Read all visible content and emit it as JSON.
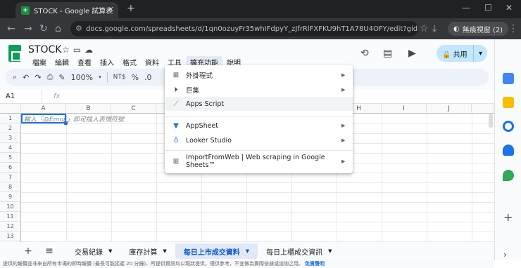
{
  "browser": {
    "tab_title": "STOCK - Google 試算表",
    "url": "docs.google.com/spreadsheets/d/1qn0ozuyFr35whIFdpyY_zJfrRlFXFKU9hT1A78U4OFY/edit?gid=138780...",
    "incognito_label": "無痕視窗 (2)"
  },
  "sheets": {
    "doc_title": "STOCK",
    "menu": [
      "檔案",
      "編輯",
      "查看",
      "插入",
      "格式",
      "資料",
      "工具",
      "擴充功能",
      "說明"
    ],
    "active_menu": "擴充功能",
    "share_label": "共用",
    "zoom": "100%",
    "currency": "NT$",
    "percent": "%",
    "decimal": ".0",
    "name_box": "A1",
    "fx": "fx",
    "cell_hint": "輸入「@Emoji」即可插入表情符號",
    "columns": [
      "A",
      "B",
      "C",
      "D",
      "E",
      "F",
      "G",
      "H",
      "I",
      "J"
    ],
    "rows": [
      "1",
      "2",
      "3",
      "4",
      "5",
      "6",
      "7",
      "8",
      "9",
      "10",
      "11",
      "12",
      "13",
      "14"
    ],
    "disclaimer": "提供的報價並非來自所有市場的即時報價 (最長可能延遲 20 分鐘)，所提供資訊均以現狀提供，僅供參考，不宜做為實際依據或諮詢之用。",
    "disclaimer_link": "免責聲明",
    "sheet_tabs": [
      "交易紀錄",
      "庫存計算",
      "每日上市成交資料",
      "每日上櫃成交資訊"
    ],
    "active_sheet": "每日上市成交資料"
  },
  "extensions_menu": {
    "items": [
      {
        "icon": "addons-icon",
        "label": "外掛程式",
        "submenu": true
      },
      {
        "icon": "macro-icon",
        "label": "巨集",
        "submenu": true
      },
      {
        "icon": "apps-script-icon",
        "label": "Apps Script",
        "submenu": false,
        "highlighted": true
      },
      {
        "icon": "appsheet-icon",
        "label": "AppSheet",
        "submenu": true
      },
      {
        "icon": "looker-studio-icon",
        "label": "Looker Studio",
        "submenu": true
      },
      {
        "icon": "importfromweb-icon",
        "label": "ImportFromWeb | Web scraping in Google Sheets™",
        "submenu": true
      }
    ]
  },
  "colors": {
    "accent": "#1a73e8",
    "share_bg": "#c2e7ff",
    "sheets_green": "#0f9d58",
    "chrome_dark": "#202124"
  }
}
